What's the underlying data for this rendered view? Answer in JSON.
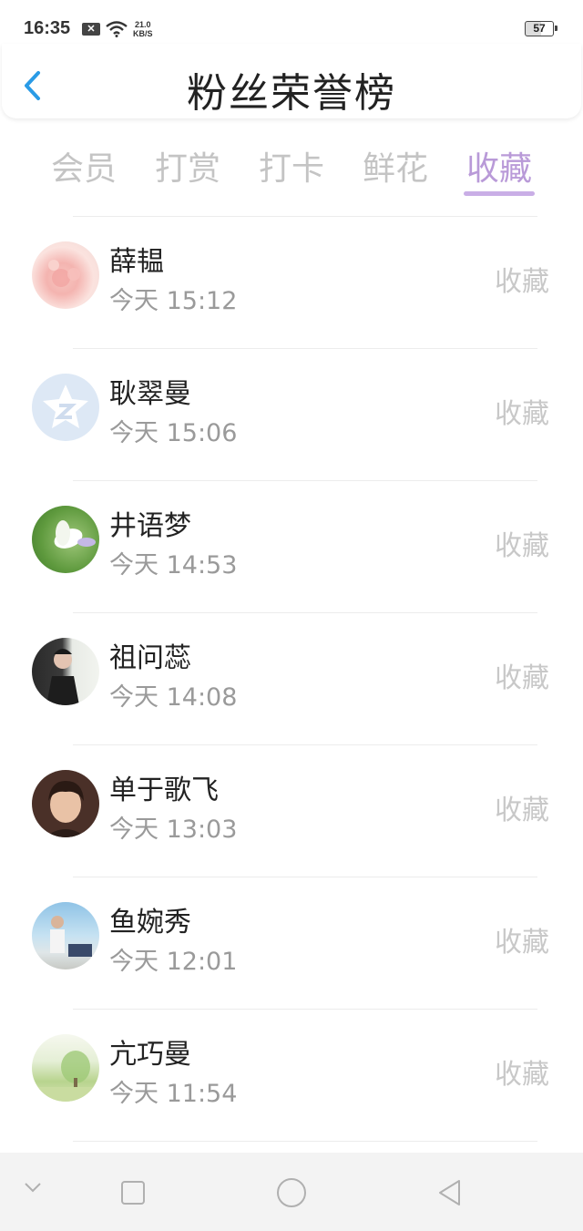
{
  "status_bar": {
    "time": "16:35",
    "network_speed_value": "21.0",
    "network_speed_unit": "KB/S",
    "battery": "57"
  },
  "header": {
    "title": "粉丝荣誉榜"
  },
  "tabs": [
    {
      "label": "会员",
      "active": false
    },
    {
      "label": "打赏",
      "active": false
    },
    {
      "label": "打卡",
      "active": false
    },
    {
      "label": "鲜花",
      "active": false
    },
    {
      "label": "收藏",
      "active": true
    }
  ],
  "list": {
    "items": [
      {
        "name": "薛韫",
        "time": "今天 15:12",
        "action": "收藏",
        "avatar": "pink-flower-avatar"
      },
      {
        "name": "耿翠曼",
        "time": "今天 15:06",
        "action": "收藏",
        "avatar": "default-star-avatar"
      },
      {
        "name": "井语梦",
        "time": "今天 14:53",
        "action": "收藏",
        "avatar": "white-flower-avatar"
      },
      {
        "name": "祖问蕊",
        "time": "今天 14:08",
        "action": "收藏",
        "avatar": "man-in-suit-avatar"
      },
      {
        "name": "单于歌飞",
        "time": "今天 13:03",
        "action": "收藏",
        "avatar": "illustrated-boy-avatar"
      },
      {
        "name": "鱼婉秀",
        "time": "今天 12:01",
        "action": "收藏",
        "avatar": "person-outdoor-avatar"
      },
      {
        "name": "亢巧曼",
        "time": "今天 11:54",
        "action": "收藏",
        "avatar": "green-tree-avatar"
      }
    ]
  },
  "colors": {
    "accent": "#b99ad8",
    "back_arrow": "#2a9be6",
    "inactive_tab": "#c4c4c4"
  }
}
